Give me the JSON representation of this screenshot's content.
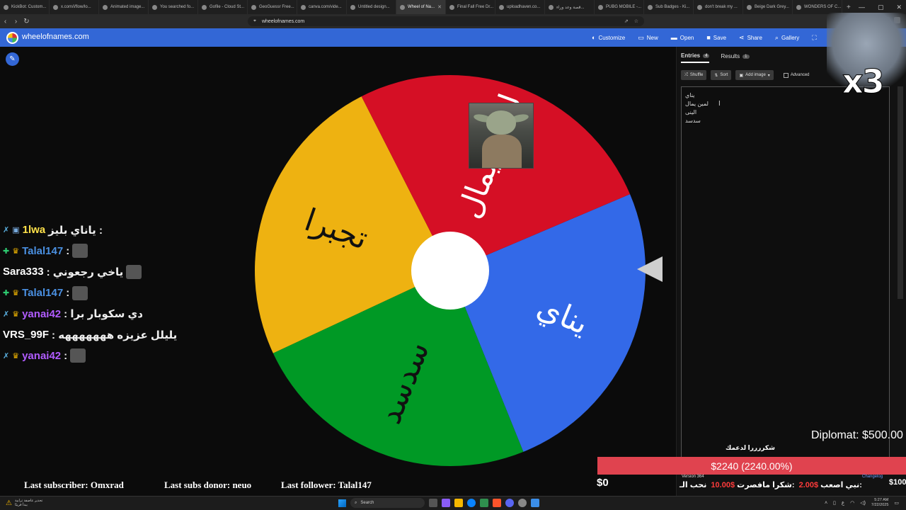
{
  "browser": {
    "tabs": [
      {
        "title": "KickBot: Custom..."
      },
      {
        "title": "x.com/i/flow/lo..."
      },
      {
        "title": "Animated image..."
      },
      {
        "title": "You searched fo..."
      },
      {
        "title": "Gofile - Cloud St..."
      },
      {
        "title": "GeoGuessr Free..."
      },
      {
        "title": "canva.com/vide..."
      },
      {
        "title": "Untitled design..."
      },
      {
        "title": "Wheel of Na...",
        "active": true
      },
      {
        "title": "Final Fall Free Dr..."
      },
      {
        "title": "uploadhaven.co..."
      },
      {
        "title": "قصة وعد وراء..."
      },
      {
        "title": "PUBG MOBILE -..."
      },
      {
        "title": "Sub Badges - Ki..."
      },
      {
        "title": "don't break my ..."
      },
      {
        "title": "Beige Dark Grey..."
      },
      {
        "title": "WONDERS OF C..."
      }
    ],
    "url": "wheelofnames.com"
  },
  "app": {
    "brand": "wheelofnames.com",
    "menu": [
      {
        "label": "Customize",
        "icon": "palette-icon",
        "glyph": "◐"
      },
      {
        "label": "New",
        "icon": "file-icon",
        "glyph": "▭"
      },
      {
        "label": "Open",
        "icon": "folder-icon",
        "glyph": "▬"
      },
      {
        "label": "Save",
        "icon": "save-icon",
        "glyph": "■"
      },
      {
        "label": "Share",
        "icon": "share-icon",
        "glyph": "⋖"
      },
      {
        "label": "Gallery",
        "icon": "search-icon",
        "glyph": "⌕"
      },
      {
        "label": "",
        "icon": "fullscreen-icon",
        "glyph": "⛶"
      }
    ]
  },
  "wheel": {
    "segments": [
      {
        "label": "يناي",
        "color": "#3369e8"
      },
      {
        "label": "سدسد",
        "color": "#009925"
      },
      {
        "label": "تجبرا",
        "color": "#eeb211"
      },
      {
        "label": "لمين يمال",
        "color": "#d50f25"
      }
    ]
  },
  "chat": [
    {
      "badges": [
        "sword",
        "emote"
      ],
      "user": "1lwa",
      "userColor": "#ffe24a",
      "text": "ياناي بليز :",
      "emote": false
    },
    {
      "badges": [
        "green",
        "crown"
      ],
      "user": "Talal147",
      "userColor": "#4a90e2",
      "text": ":",
      "emote": true
    },
    {
      "badges": [],
      "user": "Sara333",
      "userColor": "#ffffff",
      "text": ": ياخي رجعوني",
      "emote": true
    },
    {
      "badges": [
        "green",
        "crown"
      ],
      "user": "Talal147",
      "userColor": "#4a90e2",
      "text": ":",
      "emote": true
    },
    {
      "badges": [
        "sword",
        "crown"
      ],
      "user": "yanai42",
      "userColor": "#b15cff",
      "text": ": دي سكوبار برا",
      "emote": false
    },
    {
      "badges": [],
      "user": "VRS_99F",
      "userColor": "#ffffff",
      "text": ": يليلل عزيزه هههههههه",
      "emote": false
    },
    {
      "badges": [
        "sword",
        "crown"
      ],
      "user": "yanai42",
      "userColor": "#b15cff",
      "text": ":",
      "emote": true
    }
  ],
  "ticker": {
    "subscriber": "Last subscriber: Omxrad",
    "donor": "Last subs donor: neuo",
    "follower": "Last follower: Talal147"
  },
  "sidebar": {
    "tabs": [
      {
        "label": "Entries",
        "count": "4",
        "active": true
      },
      {
        "label": "Results",
        "count": "1",
        "active": false
      }
    ],
    "tools": {
      "shuffle": "Shuffle",
      "sort": "Sort",
      "add_image": "Add image",
      "advanced": "Advanced"
    },
    "entries": [
      "يناي",
      "لمين يمال",
      "الينى",
      "سدسد"
    ],
    "version": "Version 364",
    "changelog": "Changelog"
  },
  "overlay": {
    "multiplier": "x3",
    "thanks": "شكررررا لدعمك",
    "diplomat": "Diplomat: $500.00",
    "goal_label": "$2240 (2240.00%)",
    "goal_start": "$0",
    "goal_end": "$100",
    "goal_fraction": 1.0,
    "donors": [
      {
        "text": "نحب الـ",
        "amount": ""
      },
      {
        "text": "شكرا مافصرت:",
        "amount": "10.00$"
      },
      {
        "text": "نبي اصعب:",
        "amount": "2.00$"
      }
    ]
  },
  "taskbar": {
    "weather_line1": "تحذير عاصفة ترابية",
    "weather_line2": "يبدأ قريبًا",
    "search": "Search",
    "time": "5:27 AM",
    "date": "7/22/2025",
    "lang": "ع"
  }
}
